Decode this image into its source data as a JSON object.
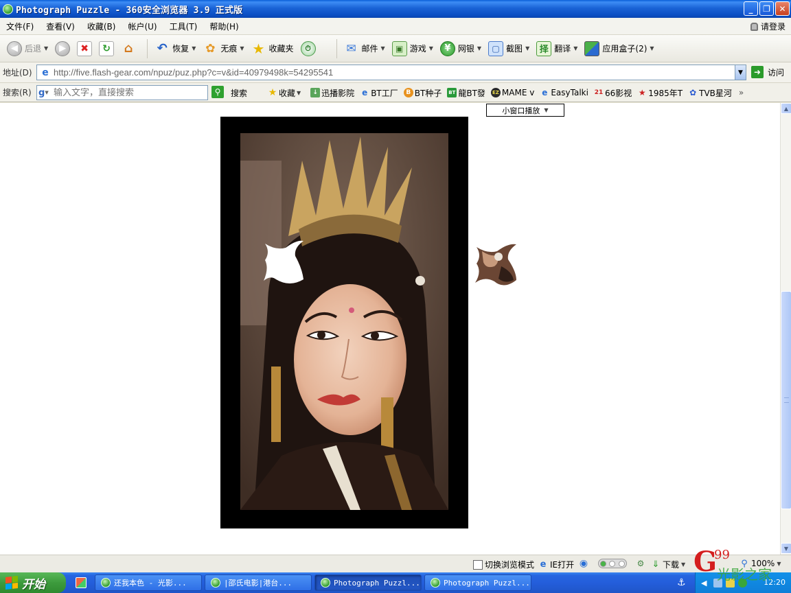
{
  "window": {
    "title": "Photograph Puzzle - 360安全浏览器 3.9 正式版",
    "controls": [
      "_",
      "❐",
      "✕"
    ]
  },
  "menu": {
    "items": [
      "文件(F)",
      "查看(V)",
      "收藏(B)",
      "帐户(U)",
      "工具(T)",
      "帮助(H)"
    ],
    "login": "请登录"
  },
  "toolbar": {
    "back": "后退",
    "restore": "恢复",
    "incognito": "无痕",
    "favorites": "收藏夹",
    "mail": "邮件",
    "games": "游戏",
    "bank": "网银",
    "screenshot": "截图",
    "translate": "翻译",
    "appbox": "应用盒子(2)"
  },
  "address": {
    "label": "地址(D)",
    "url": "http://five.flash-gear.com/npuz/puz.php?c=v&id=40979498k=54295541",
    "go": "访问"
  },
  "search": {
    "label": "搜索(R)",
    "placeholder": "输入文字，直接搜索",
    "button": "搜索",
    "favorites": [
      "收藏",
      "迅播影院",
      "BT工厂",
      "BT种子",
      "龍BT發",
      "MAME v",
      "EasyTalki",
      "66影视",
      "1985年T",
      "TVB星河"
    ],
    "more": "»"
  },
  "content": {
    "popup_button": "小窗口播放"
  },
  "status": {
    "switch_mode": "切换浏览模式",
    "ie_open": "IE打开",
    "download": "下载",
    "zoom": "100%"
  },
  "taskbar": {
    "start": "开始",
    "tasks": [
      "还我本色 - 光影...",
      "|邵氏电影|港台...",
      "Photograph Puzzl...",
      "Photograph Puzzl..."
    ],
    "clock": "12:20"
  },
  "colors": {
    "titlebar": "#1a63d6",
    "taskbar": "#245edb",
    "start_green": "#3d9b3d",
    "frame": "#000000"
  }
}
